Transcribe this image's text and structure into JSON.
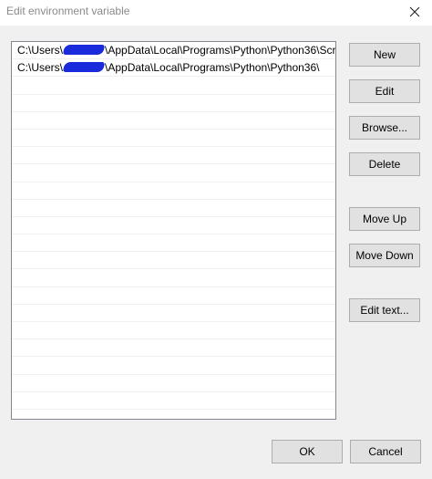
{
  "window": {
    "title": "Edit environment variable"
  },
  "list": {
    "items": [
      {
        "prefix": "C:\\Users\\",
        "suffix": "\\AppData\\Local\\Programs\\Python\\Python36\\Scr..."
      },
      {
        "prefix": "C:\\Users\\",
        "suffix": "\\AppData\\Local\\Programs\\Python\\Python36\\"
      }
    ],
    "empty_row_count": 19
  },
  "buttons": {
    "new": "New",
    "edit": "Edit",
    "browse": "Browse...",
    "delete": "Delete",
    "move_up": "Move Up",
    "move_down": "Move Down",
    "edit_text": "Edit text...",
    "ok": "OK",
    "cancel": "Cancel"
  },
  "colors": {
    "redaction": "#1a2bdc",
    "dialog_bg": "#f0f0f0",
    "button_bg": "#e1e1e1"
  }
}
